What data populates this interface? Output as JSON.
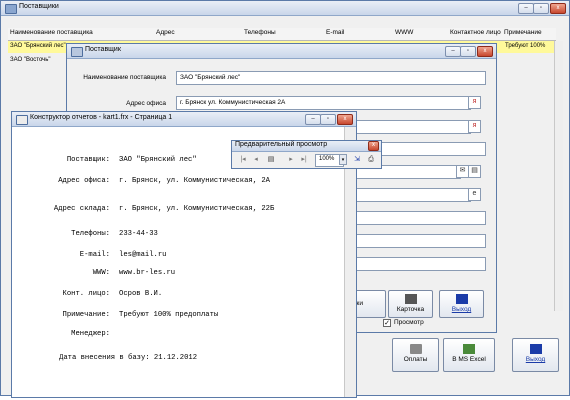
{
  "main_window": {
    "title": "Поставщики",
    "columns": [
      "Наименование поставщика",
      "Адрес",
      "Телефоны",
      "E-mail",
      "WWW",
      "Контактное лицо",
      "Примечание"
    ],
    "rows": [
      {
        "name": "ЗАО \"Брянский лес\"",
        "note": "Требуют 100%"
      },
      {
        "name": "ЗАО \"Восточь\""
      }
    ],
    "buttons": {
      "payments": "Оплаты",
      "excel": "В MS Excel",
      "exit": "Выход"
    }
  },
  "supplier_window": {
    "title": "Поставщик",
    "fields": [
      {
        "label": "Наименование поставщика",
        "value": "ЗАО \"Брянский лес\""
      },
      {
        "label": "Адрес офиса",
        "value": "г. Брянск ул. Коммунистическая 2А"
      }
    ],
    "buttons": {
      "partial_left": "жи",
      "card": "Карточка",
      "exit": "Выход"
    },
    "preview_checkbox": {
      "label": "Просмотр",
      "checked": true
    }
  },
  "report_window": {
    "title": "Конструктор отчетов - kart1.frx - Страница 1",
    "lines": [
      {
        "label": "Поставщик:",
        "value": "ЗАО \"Брянский лес\""
      },
      {
        "label": "Адрес офиса:",
        "value": "г. Брянск, ул. Коммунистическая, 2А"
      },
      {
        "label": "Адрес склада:",
        "value": "г. Брянск, ул. Коммунистическая, 22Б"
      },
      {
        "label": "Телефоны:",
        "value": "233-44-33"
      },
      {
        "label": "E-mail:",
        "value": "les@mail.ru"
      },
      {
        "label": "WWW:",
        "value": "www.br-les.ru"
      },
      {
        "label": "Конт. лицо:",
        "value": "Осров В.И."
      },
      {
        "label": "Примечание:",
        "value": "Требуют 100% предоплаты"
      },
      {
        "label": "Менеджер:",
        "value": ""
      }
    ],
    "footer": "Дата внесения в базу: 21.12.2012"
  },
  "preview_toolbar": {
    "title": "Предварительный просмотр",
    "zoom": "100%"
  },
  "colors": {
    "selected_row": "#fff99a",
    "title_gradient": "#c9d6ea",
    "close_red": "#c8472e"
  }
}
